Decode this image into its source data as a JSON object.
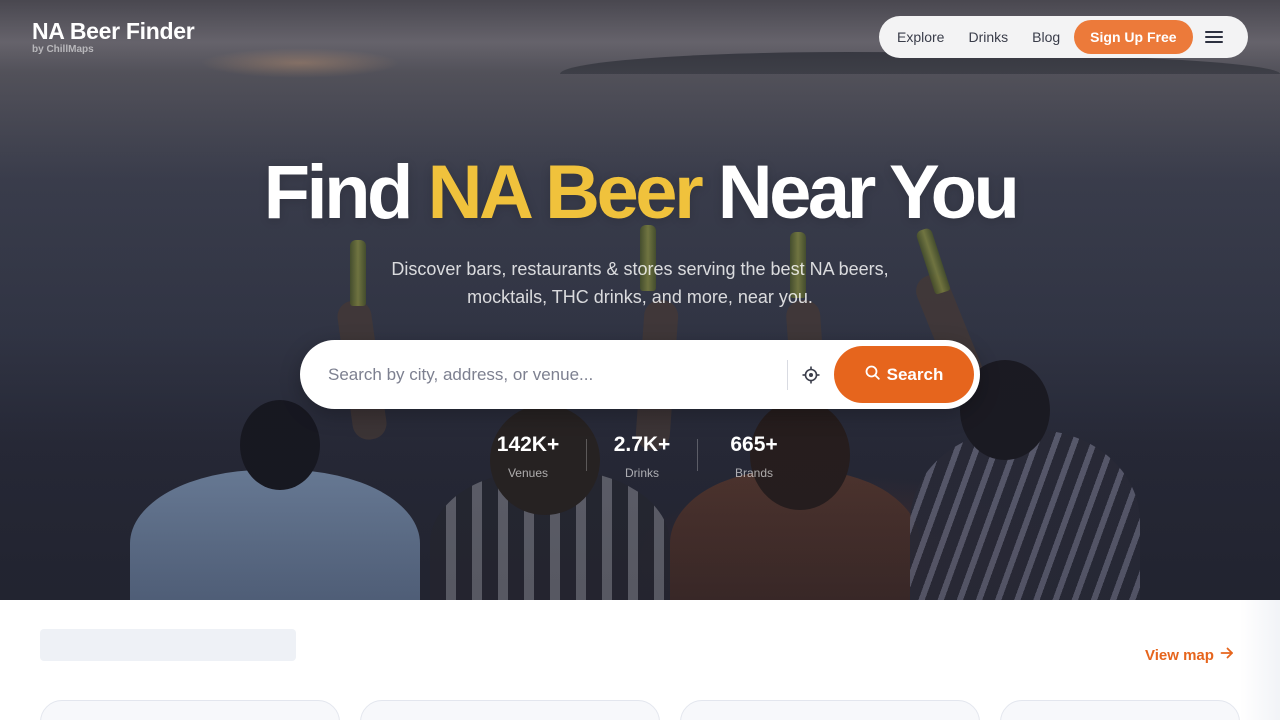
{
  "brand": {
    "title": "NA Beer Finder",
    "subtitle": "by ChillMaps"
  },
  "nav": {
    "links": [
      "Explore",
      "Drinks",
      "Blog"
    ],
    "signup_label": "Sign Up Free",
    "menu_icon": "hamburger-menu-icon"
  },
  "hero": {
    "headline_start": "Find",
    "headline_accent": "NA Beer",
    "headline_end": "Near You",
    "subtitle": "Discover bars, restaurants & stores serving the best NA beers, mocktails, THC drinks, and more, near you."
  },
  "search": {
    "placeholder": "Search by city, address, or venue...",
    "value": "",
    "locate_icon": "crosshair-location-icon",
    "button_label": "Search",
    "button_icon": "search-icon"
  },
  "stats": [
    {
      "value": "142K+",
      "label": "Venues"
    },
    {
      "value": "2.7K+",
      "label": "Drinks"
    },
    {
      "value": "665+",
      "label": "Brands"
    }
  ],
  "section": {
    "view_map_label": "View map",
    "view_map_icon": "arrow-right-icon"
  },
  "colors": {
    "accent_orange": "#e6651d",
    "signup_orange": "#ec7a3a",
    "headline_accent": "#f0c23c"
  }
}
